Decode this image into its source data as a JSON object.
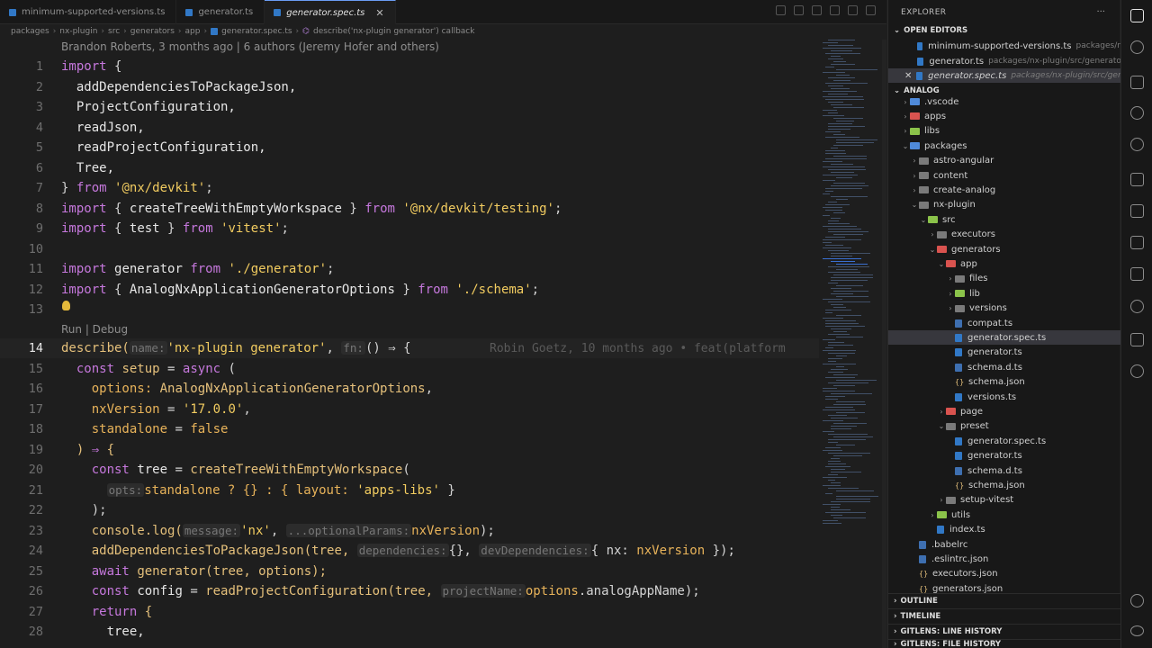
{
  "tabs": [
    {
      "label": "minimum-supported-versions.ts",
      "active": false
    },
    {
      "label": "generator.ts",
      "active": false
    },
    {
      "label": "generator.spec.ts",
      "active": true
    }
  ],
  "breadcrumb": [
    "packages",
    "nx-plugin",
    "src",
    "generators",
    "app",
    "generator.spec.ts",
    "describe('nx-plugin generator') callback"
  ],
  "codelens": {
    "blame_top": "Brandon Roberts, 3 months ago | 6 authors (Jeremy Hofer and others)",
    "run_debug": "Run | Debug"
  },
  "inline_blame": "Robin Goetz, 10 months ago • feat(platform",
  "line_numbers": [
    "1",
    "2",
    "3",
    "4",
    "5",
    "6",
    "7",
    "8",
    "9",
    "10",
    "11",
    "12",
    "13",
    "14",
    "15",
    "16",
    "17",
    "18",
    "19",
    "20",
    "21",
    "22",
    "23",
    "24",
    "25",
    "26",
    "27",
    "28"
  ],
  "code": {
    "l1": [
      "import",
      "{"
    ],
    "l2": "addDependenciesToPackageJson,",
    "l3": "ProjectConfiguration,",
    "l4": "readJson,",
    "l5": "readProjectConfiguration,",
    "l6": "Tree,",
    "l7": [
      "}",
      "from",
      "'@nx/devkit'",
      ";"
    ],
    "l8": [
      "import",
      "{",
      "createTreeWithEmptyWorkspace",
      "}",
      "from",
      "'@nx/devkit/testing'",
      ";"
    ],
    "l9": [
      "import",
      "{",
      "test",
      "}",
      "from",
      "'vitest'",
      ";"
    ],
    "l11": [
      "import",
      "generator",
      "from",
      "'./generator'",
      ";"
    ],
    "l12": [
      "import",
      "{",
      "AnalogNxApplicationGeneratorOptions",
      "}",
      "from",
      "'./schema'",
      ";"
    ],
    "l14": [
      "describe(",
      "name:",
      "'nx-plugin generator'",
      ", ",
      "fn:",
      "() ⇒ {"
    ],
    "l15": [
      "const",
      "setup",
      "=",
      "async",
      "("
    ],
    "l16": [
      "options:",
      "AnalogNxApplicationGeneratorOptions",
      ","
    ],
    "l17": [
      "nxVersion",
      "=",
      "'17.0.0'",
      ","
    ],
    "l18": [
      "standalone",
      "=",
      "false"
    ],
    "l19": [
      ")",
      "⇒",
      "{"
    ],
    "l20": [
      "const",
      "tree",
      "=",
      "createTreeWithEmptyWorkspace",
      "("
    ],
    "l21": [
      "opts:",
      "standalone ? {} : { layout: ",
      "'apps-libs'",
      " }"
    ],
    "l22": ");",
    "l23": [
      "console.log(",
      "message:",
      "'nx'",
      ", ",
      "...optionalParams:",
      "nxVersion",
      ");"
    ],
    "l24": [
      "addDependenciesToPackageJson(tree, ",
      "dependencies:",
      "{}, ",
      "devDependencies:",
      "{ nx: ",
      "nxVersion",
      " });"
    ],
    "l25": [
      "await",
      "generator(tree, options);"
    ],
    "l26": [
      "const",
      "config",
      "=",
      "readProjectConfiguration(tree, ",
      "projectName:",
      "options",
      ".analogAppName);"
    ],
    "l27": [
      "return",
      "{"
    ],
    "l28": "tree,"
  },
  "explorer": {
    "title": "EXPLORER",
    "open_editors_label": "OPEN EDITORS",
    "open_editors": [
      {
        "name": "minimum-supported-versions.ts",
        "desc": "packages/nx..."
      },
      {
        "name": "generator.ts",
        "desc": "packages/nx-plugin/src/generator..."
      },
      {
        "name": "generator.spec.ts",
        "desc": "packages/nx-plugin/src/gen..."
      }
    ],
    "root_label": "ANALOG",
    "tree": [
      ".vscode",
      "apps",
      "libs",
      "packages",
      "astro-angular",
      "content",
      "create-analog",
      "nx-plugin",
      "src",
      "executors",
      "generators",
      "app",
      "files",
      "lib",
      "versions",
      "compat.ts",
      "generator.spec.ts",
      "generator.ts",
      "schema.d.ts",
      "schema.json",
      "versions.ts",
      "page",
      "preset",
      "generator.spec.ts",
      "generator.ts",
      "schema.d.ts",
      "schema.json",
      "setup-vitest",
      "utils",
      "index.ts",
      ".babelrc",
      ".eslintrc.json",
      "executors.json",
      "generators.json"
    ],
    "outline": "OUTLINE",
    "timeline": "TIMELINE",
    "gitlens_line": "GITLENS: LINE HISTORY",
    "gitlens_file": "GITLENS: FILE HISTORY"
  },
  "colors": {
    "keyword": "#c678dd",
    "function": "#e5c07b",
    "string": "#f2cc60",
    "accent": "#3178c6"
  }
}
